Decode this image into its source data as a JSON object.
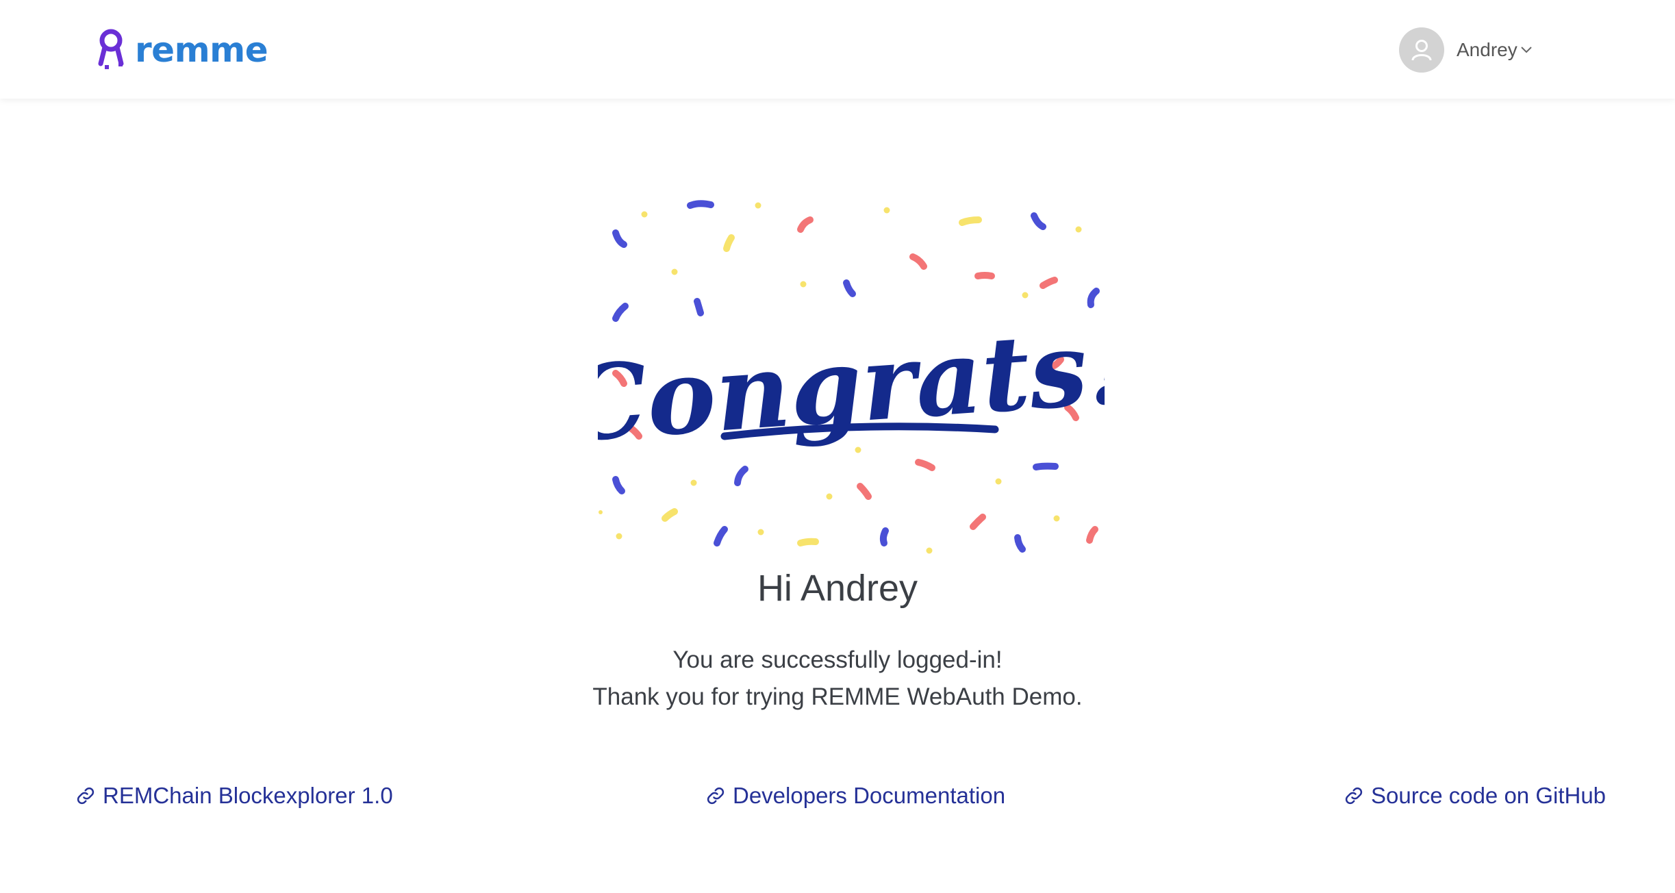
{
  "header": {
    "logo_text": "remme",
    "user_name": "Andrey",
    "icons": {
      "logo": "remme-key-logo-icon",
      "avatar": "user-avatar-icon",
      "dropdown": "chevron-down-icon"
    }
  },
  "hero": {
    "image_text": "Congrats!",
    "image_icon": "congrats-confetti-illustration"
  },
  "main": {
    "greeting": "Hi Andrey",
    "message_line1": "You are successfully logged-in!",
    "message_line2": "Thank you for trying REMME WebAuth Demo."
  },
  "links": [
    {
      "label": "REMChain Blockexplorer 1.0",
      "icon": "link-icon"
    },
    {
      "label": "Developers Documentation",
      "icon": "link-icon"
    },
    {
      "label": "Source code on GitHub",
      "icon": "link-icon"
    }
  ],
  "colors": {
    "brand": "#2a7fd4",
    "logo_mark": "#6a2fd6",
    "link": "#253197",
    "text": "#3b3f45",
    "congrats": "#142a8c",
    "confetti_blue": "#4a50d6",
    "confetti_red": "#f37576",
    "confetti_yellow": "#f7e36c"
  }
}
